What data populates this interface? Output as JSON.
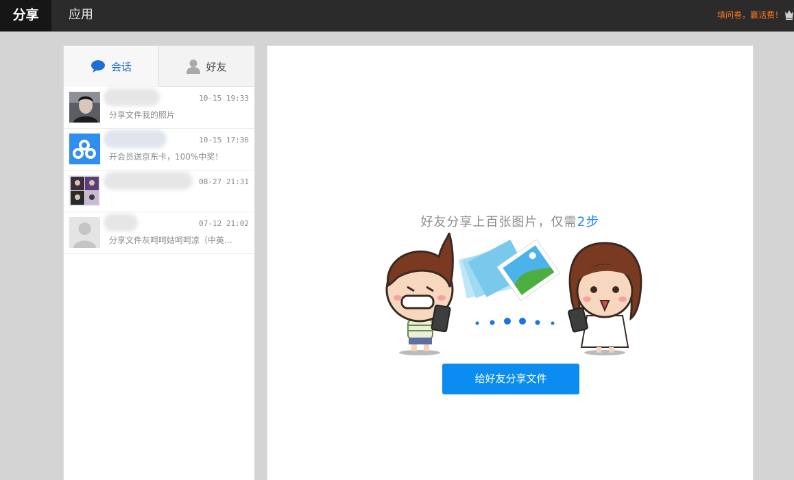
{
  "topbar": {
    "tab_share": "分享",
    "tab_apps": "应用",
    "promo_text": "填问卷，赢话费！",
    "accent_color": "#ff7a1f"
  },
  "left_panel": {
    "tabs": [
      {
        "label": "会话",
        "icon": "chat-bubble-icon",
        "active": true
      },
      {
        "label": "好友",
        "icon": "user-icon",
        "active": false
      }
    ],
    "conversations": [
      {
        "time": "10-15 19:33",
        "preview": "分享文件我的照片",
        "avatar": "photo-avatar"
      },
      {
        "time": "10-15 17:36",
        "preview": "开会员送京东卡，100%中奖！",
        "avatar": "baidu-cloud-logo-avatar"
      },
      {
        "time": "08-27 21:31",
        "preview": "",
        "avatar": "group-collage-avatar"
      },
      {
        "time": "07-12 21:02",
        "preview": "分享文件灰呵呵姑呵呵凉（中英…",
        "avatar": "default-user-avatar"
      }
    ]
  },
  "main": {
    "headline_prefix": "好友分享上百张图片，仅需",
    "headline_number": "2",
    "headline_suffix": "步",
    "share_button_label": "给好友分享文件",
    "accent_color": "#0a8cf0"
  }
}
